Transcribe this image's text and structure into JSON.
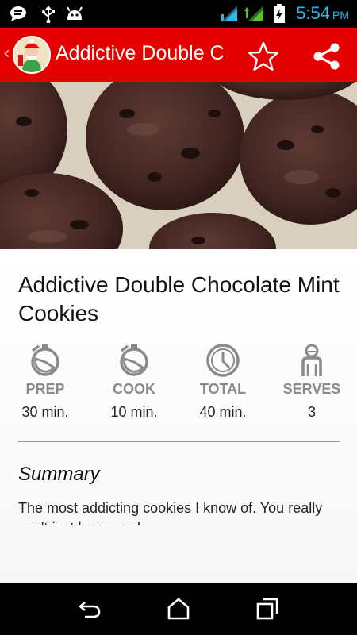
{
  "status_bar": {
    "time": "5:54",
    "ampm": "PM",
    "time_color": "#33b5e5",
    "icons": [
      "chat-notification-icon",
      "usb-icon",
      "android-debug-icon",
      "wifi-signal-icon",
      "cell-signal-icon",
      "battery-charging-icon"
    ]
  },
  "action_bar": {
    "title": "Addictive Double Chocolate Mint Cookies",
    "background": "#e50000",
    "icons": [
      "up-caret-icon",
      "app-logo-icon",
      "star-outline-icon",
      "share-icon"
    ]
  },
  "recipe": {
    "title": "Addictive Double Chocolate Mint Cookies",
    "stats": [
      {
        "icon": "prep-timer-icon",
        "label": "PREP",
        "value": "30 min."
      },
      {
        "icon": "cook-timer-icon",
        "label": "COOK",
        "value": "10 min."
      },
      {
        "icon": "total-clock-icon",
        "label": "TOTAL",
        "value": "40 min."
      },
      {
        "icon": "serves-person-icon",
        "label": "SERVES",
        "value": "3"
      }
    ],
    "summary_heading": "Summary",
    "summary_text": "The most addicting cookies I know of. You really can't just have one!"
  },
  "nav_bar": {
    "buttons": [
      "back-icon",
      "home-icon",
      "recent-apps-icon"
    ]
  }
}
